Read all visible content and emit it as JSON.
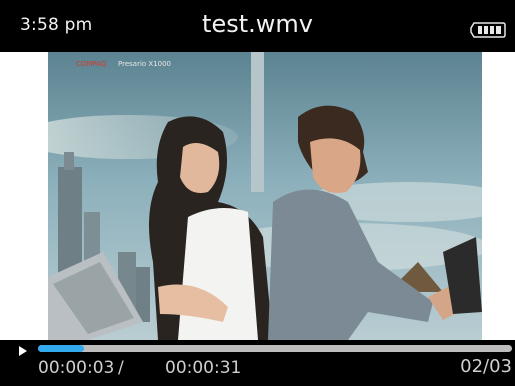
{
  "status_bar": {
    "time": "3:58 pm",
    "title": "test.wmv",
    "battery_icon": "battery-full-icon"
  },
  "video": {
    "brand_text": "COMPAQ",
    "model_text": "Presario X1000"
  },
  "player": {
    "play_icon": "play-icon",
    "progress": 0.097,
    "elapsed": "00:00:03",
    "separator": "/",
    "duration": "00:00:31",
    "file_index": "02/03"
  },
  "colors": {
    "progress_fill": "#33aaee",
    "track": "#bdbdbd",
    "bars": "#000000"
  }
}
